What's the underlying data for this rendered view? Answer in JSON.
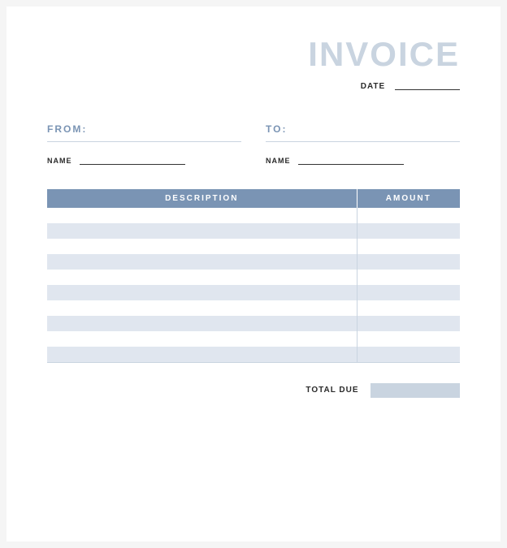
{
  "header": {
    "title": "INVOICE",
    "date_label": "DATE"
  },
  "from": {
    "section_label": "FROM:",
    "name_label": "NAME"
  },
  "to": {
    "section_label": "TO:",
    "name_label": "NAME"
  },
  "table": {
    "columns": {
      "description": "DESCRIPTION",
      "amount": "AMOUNT"
    },
    "rows": [
      {
        "description": "",
        "amount": ""
      },
      {
        "description": "",
        "amount": ""
      },
      {
        "description": "",
        "amount": ""
      },
      {
        "description": "",
        "amount": ""
      },
      {
        "description": "",
        "amount": ""
      },
      {
        "description": "",
        "amount": ""
      },
      {
        "description": "",
        "amount": ""
      },
      {
        "description": "",
        "amount": ""
      },
      {
        "description": "",
        "amount": ""
      },
      {
        "description": "",
        "amount": ""
      }
    ]
  },
  "total": {
    "label": "TOTAL DUE",
    "value": ""
  }
}
